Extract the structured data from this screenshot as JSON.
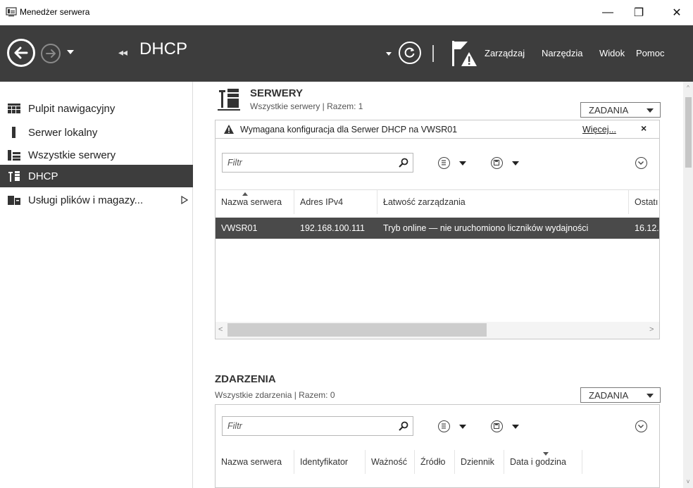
{
  "window": {
    "title": "Menedżer serwera",
    "min_glyph": "—",
    "max_glyph": "❐",
    "close_glyph": "✕"
  },
  "toolbar": {
    "crumb_arrows": "◂◂",
    "crumb_title": "DHCP",
    "menu": [
      "Zarządzaj",
      "Narzędzia",
      "Widok",
      "Pomoc"
    ]
  },
  "sidebar": {
    "items": [
      {
        "label": "Pulpit nawigacyjny",
        "icon": "dashboard-icon"
      },
      {
        "label": "Serwer lokalny",
        "icon": "server-icon"
      },
      {
        "label": "Wszystkie serwery",
        "icon": "servers-icon"
      },
      {
        "label": "DHCP",
        "icon": "dhcp-icon",
        "active": true
      },
      {
        "label": "Usługi plików i magazy...",
        "icon": "file-services-icon",
        "has_submenu": true
      }
    ]
  },
  "servers": {
    "title": "SERWERY",
    "subtitle": "Wszystkie serwery | Razem: 1",
    "tasks_label": "ZADANIA",
    "warning": {
      "text": "Wymagana konfiguracja dla Serwer DHCP na VWSR01",
      "more": "Więcej...",
      "close": "×"
    },
    "filter_placeholder": "Filtr",
    "columns": [
      "Nazwa serwera",
      "Adres IPv4",
      "Łatwość zarządzania",
      "Ostatı"
    ],
    "rows": [
      [
        "VWSR01",
        "192.168.100.111",
        "Tryb online — nie uruchomiono liczników wydajności",
        "16.12."
      ]
    ],
    "hscroll_left": "<",
    "hscroll_right": ">"
  },
  "events": {
    "title": "ZDARZENIA",
    "subtitle": "Wszystkie zdarzenia | Razem: 0",
    "tasks_label": "ZADANIA",
    "filter_placeholder": "Filtr",
    "columns": [
      "Nazwa serwera",
      "Identyfikator",
      "Ważność",
      "Źródło",
      "Dziennik",
      "Data i godzina"
    ]
  },
  "scrollbar": {
    "up": "^",
    "down": "v"
  }
}
